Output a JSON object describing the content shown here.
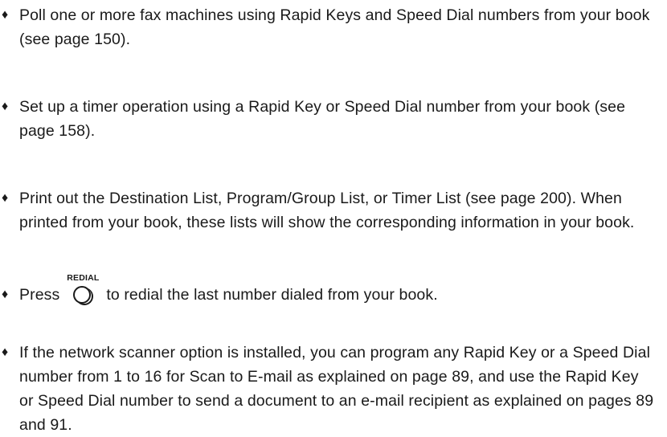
{
  "bullet_symbol": "♦",
  "items": [
    {
      "text": "Poll one or more fax machines using Rapid Keys and Speed Dial numbers from your book (see page 150)."
    },
    {
      "text": "Set up a timer operation using a Rapid Key or Speed Dial number from your book (see page 158)."
    },
    {
      "text": "Print out the Destination List, Program/Group List, or Timer List (see page 200). When printed from your book, these lists will show the corresponding information in your book."
    },
    {
      "text_before": "Press",
      "key_label": "REDIAL",
      "text_after": "to redial the last number dialed from your book."
    },
    {
      "text": "If the network scanner option is installed, you can program any Rapid Key or a Speed Dial number from 1 to 16 for Scan to E-mail as explained on page 89, and use the Rapid Key or Speed Dial number to send a document to an e-mail recipient as explained on pages 89 and 91."
    }
  ]
}
